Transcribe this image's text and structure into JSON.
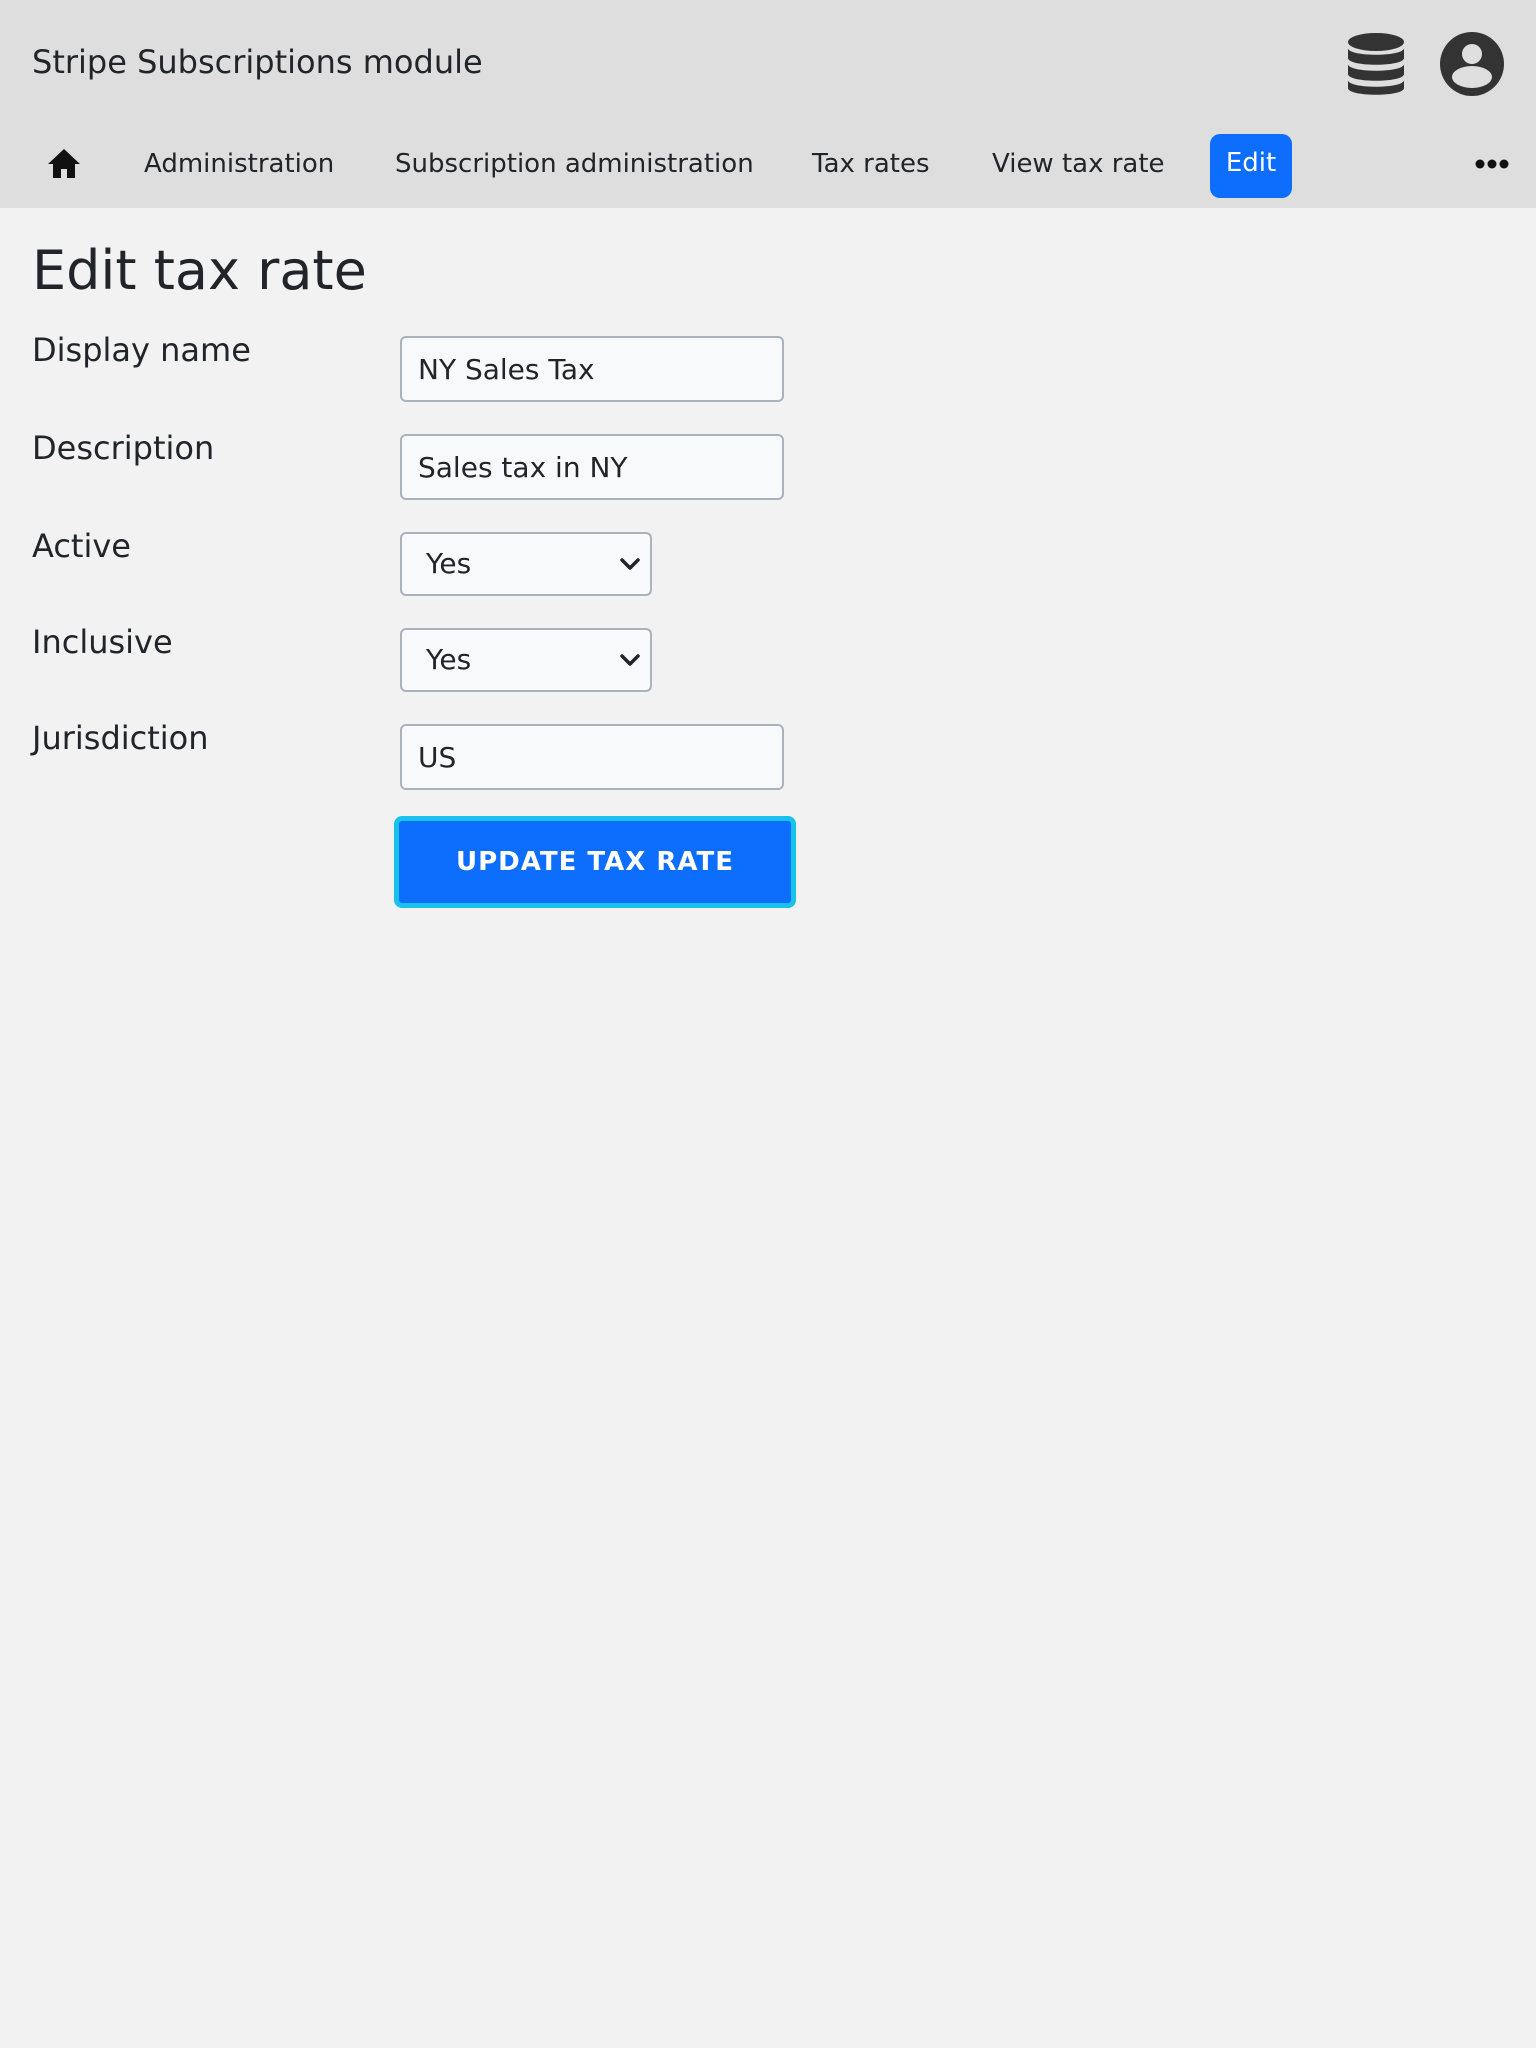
{
  "header": {
    "app_title": "Stripe Subscriptions module",
    "icons": [
      "database-icon",
      "user-account-icon"
    ]
  },
  "breadcrumb": {
    "home_icon": "home-icon",
    "items": [
      "Administration",
      "Subscription administration",
      "Tax rates",
      "View tax rate"
    ],
    "active": "Edit",
    "more_icon": "more-options-icon"
  },
  "page": {
    "title": "Edit tax rate"
  },
  "form": {
    "display_name": {
      "label": "Display name",
      "value": "NY Sales Tax"
    },
    "description": {
      "label": "Description",
      "value": "Sales tax in NY"
    },
    "active": {
      "label": "Active",
      "value": "Yes"
    },
    "inclusive": {
      "label": "Inclusive",
      "value": "Yes"
    },
    "jurisdiction": {
      "label": "Jurisdiction",
      "value": "US"
    },
    "submit_label": "UPDATE TAX RATE"
  },
  "colors": {
    "primary": "#0d6efd",
    "focus_ring": "#18c2ea",
    "header_bg": "#dedede",
    "page_bg": "#f2f2f2"
  }
}
